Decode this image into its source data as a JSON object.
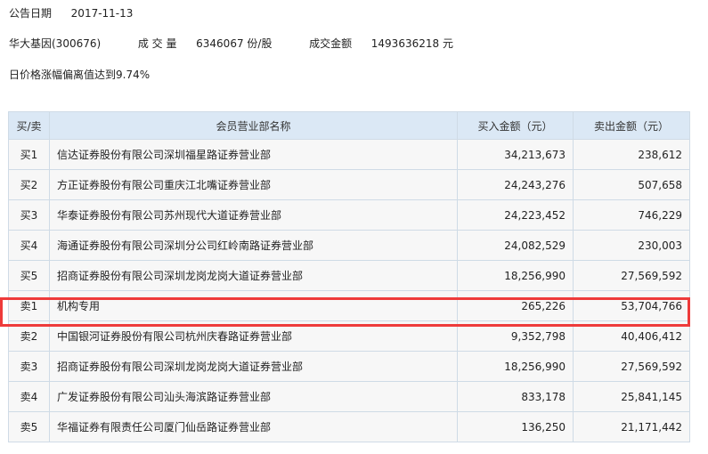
{
  "announcement": {
    "date_label": "公告日期",
    "date_value": "2017-11-13"
  },
  "stock": {
    "name_code": "华大基因(300676)",
    "volume_label": "成 交 量",
    "volume_value": "6346067 份/股",
    "amount_label": "成交金额",
    "amount_value": "1493636218 元"
  },
  "reason": "日价格涨幅偏离值达到9.74%",
  "table": {
    "headers": [
      "买/卖",
      "会员营业部名称",
      "买入金额（元）",
      "卖出金额（元）"
    ],
    "rows": [
      {
        "side": "买1",
        "name": "信达证券股份有限公司深圳福星路证券营业部",
        "buy": "34,213,673",
        "sell": "238,612"
      },
      {
        "side": "买2",
        "name": "方正证券股份有限公司重庆江北嘴证券营业部",
        "buy": "24,243,276",
        "sell": "507,658"
      },
      {
        "side": "买3",
        "name": "华泰证券股份有限公司苏州现代大道证券营业部",
        "buy": "24,223,452",
        "sell": "746,229"
      },
      {
        "side": "买4",
        "name": "海通证券股份有限公司深圳分公司红岭南路证券营业部",
        "buy": "24,082,529",
        "sell": "230,003"
      },
      {
        "side": "买5",
        "name": "招商证券股份有限公司深圳龙岗龙岗大道证券营业部",
        "buy": "18,256,990",
        "sell": "27,569,592"
      },
      {
        "side": "卖1",
        "name": "机构专用",
        "buy": "265,226",
        "sell": "53,704,766"
      },
      {
        "side": "卖2",
        "name": "中国银河证券股份有限公司杭州庆春路证券营业部",
        "buy": "9,352,798",
        "sell": "40,406,412"
      },
      {
        "side": "卖3",
        "name": "招商证券股份有限公司深圳龙岗龙岗大道证券营业部",
        "buy": "18,256,990",
        "sell": "27,569,592"
      },
      {
        "side": "卖4",
        "name": "广发证券股份有限公司汕头海滨路证券营业部",
        "buy": "833,178",
        "sell": "25,841,145"
      },
      {
        "side": "卖5",
        "name": "华福证券有限责任公司厦门仙岳路证券营业部",
        "buy": "136,250",
        "sell": "21,171,442"
      }
    ]
  },
  "colors": {
    "header_bg": "#dbe8f5",
    "border": "#cfdbe6",
    "highlight": "#ee3b3b"
  }
}
